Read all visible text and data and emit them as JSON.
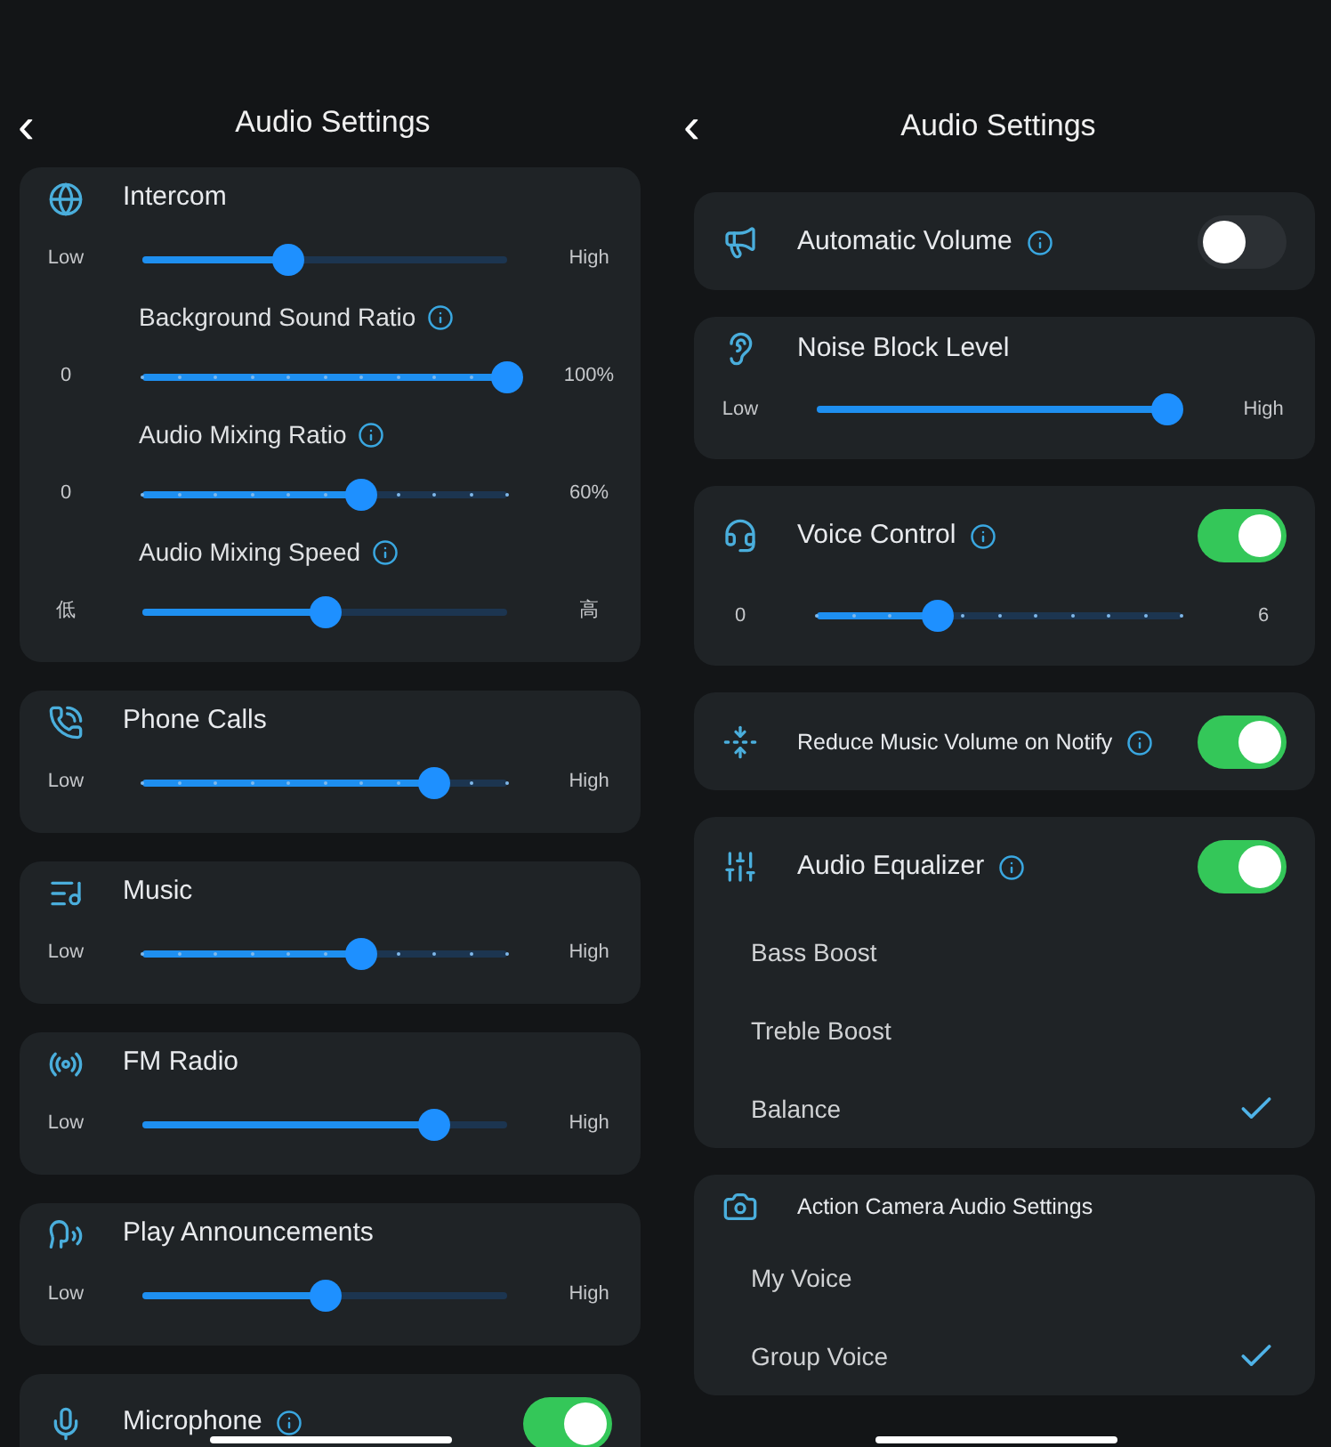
{
  "screens": [
    {
      "back": "‹",
      "title": "Audio Settings",
      "cards": [
        {
          "title": "Intercom",
          "info": false,
          "sliders": [
            {
              "low": "Low",
              "high": "High",
              "level": 0.4,
              "kind": "smooth"
            },
            {
              "label": "Background Sound Ratio",
              "info": true,
              "low": "0",
              "high": "100%",
              "level": 1.0,
              "kind": "stepped"
            },
            {
              "label": "Audio Mixing Ratio",
              "info": true,
              "low": "0",
              "high": "60%",
              "level": 0.6,
              "kind": "stepped"
            },
            {
              "label": "Audio Mixing Speed",
              "info": true,
              "low": "低",
              "high": "高",
              "level": 0.5,
              "kind": "smooth"
            }
          ]
        },
        {
          "title": "Phone Calls",
          "info": false,
          "sliders": [
            {
              "low": "Low",
              "high": "High",
              "level": 0.8,
              "kind": "stepped"
            }
          ]
        },
        {
          "title": "Music",
          "info": false,
          "sliders": [
            {
              "low": "Low",
              "high": "High",
              "level": 0.6,
              "kind": "stepped"
            }
          ]
        },
        {
          "title": "FM Radio",
          "info": false,
          "sliders": [
            {
              "low": "Low",
              "high": "High",
              "level": 0.8,
              "kind": "smooth"
            }
          ]
        },
        {
          "title": "Play Announcements",
          "info": false,
          "sliders": [
            {
              "low": "Low",
              "high": "High",
              "level": 0.5,
              "kind": "smooth"
            }
          ]
        },
        {
          "title": "Microphone",
          "info": true,
          "toggle": {
            "on": true
          }
        }
      ]
    },
    {
      "back": "‹",
      "title": "Audio Settings",
      "cards": [
        {
          "title": "Automatic Volume",
          "info": true,
          "toggle": {
            "on": false
          }
        },
        {
          "title": "Noise Block Level",
          "info": false,
          "sliders": [
            {
              "low": "Low",
              "high": "High",
              "level": 0.96,
              "kind": "smooth"
            }
          ]
        },
        {
          "title": "Voice Control",
          "info": true,
          "toggle": {
            "on": true
          },
          "sliders": [
            {
              "low": "0",
              "high": "6",
              "level": 0.33,
              "kind": "stepped"
            }
          ]
        },
        {
          "title": "Reduce Music Volume on Notify",
          "info": true,
          "toggle": {
            "on": true
          }
        },
        {
          "title": "Audio Equalizer",
          "info": true,
          "toggle": {
            "on": true
          },
          "options": [
            {
              "label": "Bass Boost",
              "selected": false
            },
            {
              "label": "Treble Boost",
              "selected": false
            },
            {
              "label": "Balance",
              "selected": true
            }
          ]
        },
        {
          "title": "Action Camera Audio Settings",
          "info": false,
          "options": [
            {
              "label": "My Voice",
              "selected": false
            },
            {
              "label": "Group Voice",
              "selected": true
            }
          ]
        }
      ]
    }
  ]
}
